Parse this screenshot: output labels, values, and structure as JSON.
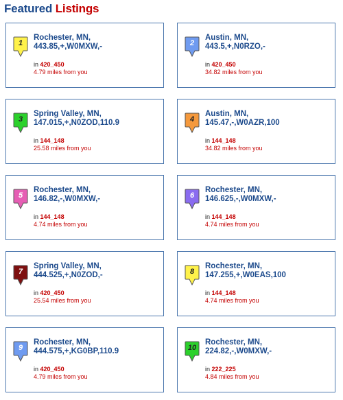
{
  "header": {
    "title_part1": "Featured",
    "title_part2": "Listings"
  },
  "listings": [
    {
      "num": "1",
      "color": "#fff24a",
      "numColor": "#222222",
      "city": "Rochester, MN,",
      "freq": "443.85,+,W0MXW,-",
      "in_label": "in",
      "area": "420_450",
      "distance": "4.79 miles from you"
    },
    {
      "num": "2",
      "color": "#6f9bf0",
      "numColor": "#ffffff",
      "city": "Austin, MN,",
      "freq": "443.5,+,N0RZO,-",
      "in_label": "in",
      "area": "420_450",
      "distance": "34.82 miles from you"
    },
    {
      "num": "3",
      "color": "#2bd12b",
      "numColor": "#222222",
      "city": "Spring Valley, MN,",
      "freq": "147.015,+,N0ZOD,110.9",
      "in_label": "in",
      "area": "144_148",
      "distance": "25.58 miles from you"
    },
    {
      "num": "4",
      "color": "#f5993c",
      "numColor": "#222222",
      "city": "Austin, MN,",
      "freq": "145.47,-,W0AZR,100",
      "in_label": "in",
      "area": "144_148",
      "distance": "34.82 miles from you"
    },
    {
      "num": "5",
      "color": "#e65eb4",
      "numColor": "#ffffff",
      "city": "Rochester, MN,",
      "freq": "146.82,-,W0MXW,-",
      "in_label": "in",
      "area": "144_148",
      "distance": "4.74 miles from you"
    },
    {
      "num": "6",
      "color": "#8a6cf0",
      "numColor": "#ffffff",
      "city": "Rochester, MN,",
      "freq": "146.625,-,W0MXW,-",
      "in_label": "in",
      "area": "144_148",
      "distance": "4.74 miles from you"
    },
    {
      "num": "7",
      "color": "#7d0f0f",
      "numColor": "#ffffff",
      "city": "Spring Valley, MN,",
      "freq": "444.525,+,N0ZOD,-",
      "in_label": "in",
      "area": "420_450",
      "distance": "25.54 miles from you"
    },
    {
      "num": "8",
      "color": "#fff24a",
      "numColor": "#222222",
      "city": "Rochester, MN,",
      "freq": "147.255,+,W0EAS,100",
      "in_label": "in",
      "area": "144_148",
      "distance": "4.74 miles from you"
    },
    {
      "num": "9",
      "color": "#6f9bf0",
      "numColor": "#ffffff",
      "city": "Rochester, MN,",
      "freq": "444.575,+,KG0BP,110.9",
      "in_label": "in",
      "area": "420_450",
      "distance": "4.79 miles from you"
    },
    {
      "num": "10",
      "color": "#2bd12b",
      "numColor": "#222222",
      "city": "Rochester, MN,",
      "freq": "224.82,-,W0MXW,-",
      "in_label": "in",
      "area": "222_225",
      "distance": "4.84 miles from you"
    }
  ]
}
